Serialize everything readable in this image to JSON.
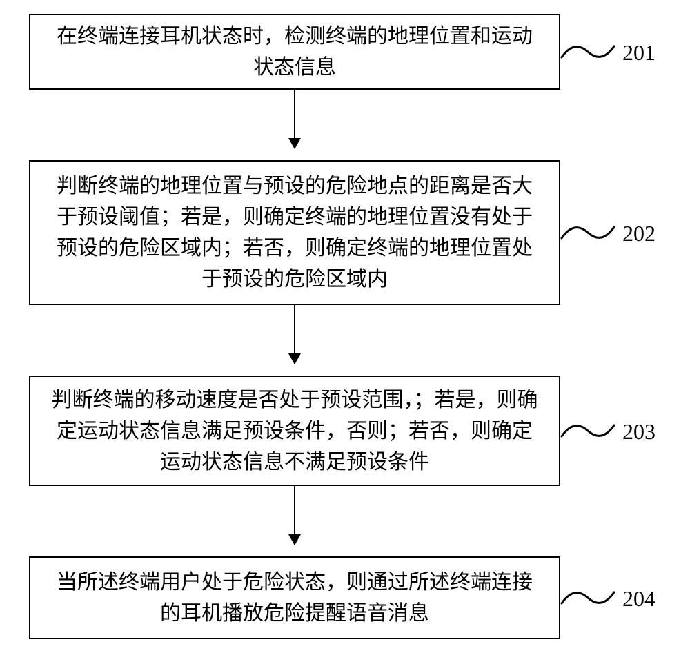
{
  "flowchart": {
    "steps": [
      {
        "num": "201",
        "text": "在终端连接耳机状态时，检测终端的地理位置和运动状态信息"
      },
      {
        "num": "202",
        "text": "判断终端的地理位置与预设的危险地点的距离是否大于预设阈值；若是，则确定终端的地理位置没有处于预设的危险区域内；若否，则确定终端的地理位置处于预设的危险区域内"
      },
      {
        "num": "203",
        "text": "判断终端的移动速度是否处于预设范围，；若是，则确定运动状态信息满足预设条件，否则；若否，则确定运动状态信息不满足预设条件"
      },
      {
        "num": "204",
        "text": "当所述终端用户处于危险状态，则通过所述终端连接的耳机播放危险提醒语音消息"
      }
    ]
  }
}
